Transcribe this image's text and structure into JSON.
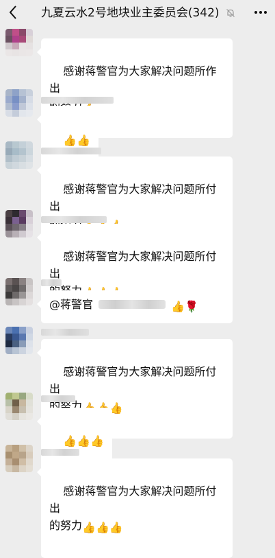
{
  "header": {
    "back_icon": "chevron-left-icon",
    "title": "九夏云水2号地块业主委员会(342)",
    "mute_icon": "bell-off-icon",
    "more_icon": "more-icon"
  },
  "emoji": {
    "thumb": "👍",
    "rose": "🌹"
  },
  "messages": [
    {
      "avatar_colors": [
        "#7a5a6e",
        "#c04f88",
        "#8a4a6a",
        "#d8d0d8",
        "#6a5060",
        "#b0408a",
        "#a84a78",
        "#e0dad8",
        "#d0c8cc",
        "#c8a8b8",
        "#e8e4e4",
        "#e6e2e2",
        "#eae6e6",
        "#e8e4e4",
        "#eae6e6",
        "#ebe7e7"
      ],
      "text": "感谢蒋警官为大家解决问题所作出\n的努力",
      "thumbs": 1
    },
    {
      "avatar_colors": [
        "#a8b4c8",
        "#8ea2c8",
        "#b6c2d4",
        "#c8d0dc",
        "#9aaacc",
        "#7890c4",
        "#a4b2cc",
        "#d6dce6",
        "#b0bcd0",
        "#8a9ccc",
        "#c0c8d8",
        "#dde2ea",
        "#d8dde6",
        "#c4ccda",
        "#e2e6ec",
        "#e6e9ee"
      ],
      "text": "",
      "thumbs": 2
    },
    {
      "avatar_colors": [
        "#a8b8c4",
        "#b8c8d0",
        "#c4d0d8",
        "#d0d8de",
        "#98aab8",
        "#a8bcc8",
        "#b4c4ce",
        "#ccd6dc",
        "#b0bec8",
        "#c0ccd4",
        "#c8d2d8",
        "#d6dde2",
        "#c8d2d8",
        "#d0d8de",
        "#d8dee2",
        "#dfe3e6"
      ],
      "text": "感谢蒋警官为大家解决问题所付出\n的努力",
      "thumbs": 3
    },
    {
      "avatar_colors": [
        "#4a4044",
        "#2e2a30",
        "#6a4a6e",
        "#c8c0c8",
        "#3a3038",
        "#7a6090",
        "#5a3a60",
        "#d8d0d8",
        "#5a5058",
        "#706870",
        "#888088",
        "#e0dce0",
        "#9a9298",
        "#b8b0b6",
        "#d0cad0",
        "#e6e2e6"
      ],
      "text": "感谢蒋警官为大家解决问题所付出\n的努力",
      "thumbs": 3
    },
    {
      "avatar_colors": [
        "#7a7070",
        "#5a5252",
        "#8a8282",
        "#c8c4c4",
        "#5c5858",
        "#4a4646",
        "#706c6c",
        "#d0cccc",
        "#3c3a3a",
        "#6e6a6a",
        "#9a9696",
        "#dcd8d8",
        "#b8b4b4",
        "#c8c4c4",
        "#d8d4d4",
        "#e4e0e0"
      ],
      "text": "@蒋警官",
      "thumbs": 1,
      "rose": true
    },
    {
      "avatar_colors": [
        "#6a86b8",
        "#4a70b0",
        "#8aa0c8",
        "#c8d0e0",
        "#2a3c60",
        "#3a5890",
        "#5a78b0",
        "#d0d8e4",
        "#1e2a40",
        "#4a6080",
        "#8a9cb8",
        "#dde2ea",
        "#a0aec4",
        "#b8c4d4",
        "#ccd4e0",
        "#e2e6ec"
      ],
      "text": "感谢蒋警官为大家解决问题所付出\n的努力",
      "thumbs": 3
    },
    {
      "avatar_colors": [
        "#a0b070",
        "#c0c890",
        "#98a880",
        "#d8dcc8",
        "#b8c0a8",
        "#70604a",
        "#c8b8a0",
        "#e0e0d8",
        "#d8d4c8",
        "#9a8870",
        "#c8c0b0",
        "#e4e2dc",
        "#e0ded8",
        "#d4d0c6",
        "#e6e4de",
        "#eae8e4"
      ],
      "text": "",
      "thumbs": 3
    },
    {
      "avatar_colors": [
        "#c8b498",
        "#b8a080",
        "#d0c0a8",
        "#dcd4c8",
        "#a89070",
        "#c0a888",
        "#b8a48a",
        "#d8ccbc",
        "#c4b098",
        "#a88e70",
        "#d0bea6",
        "#e0d8cc",
        "#d6ccbc",
        "#c8b8a2",
        "#ddd4c6",
        "#e4ded4"
      ],
      "text": "感谢蒋警官为大家解决问题所付出\n的努力",
      "thumbs": 3
    }
  ]
}
